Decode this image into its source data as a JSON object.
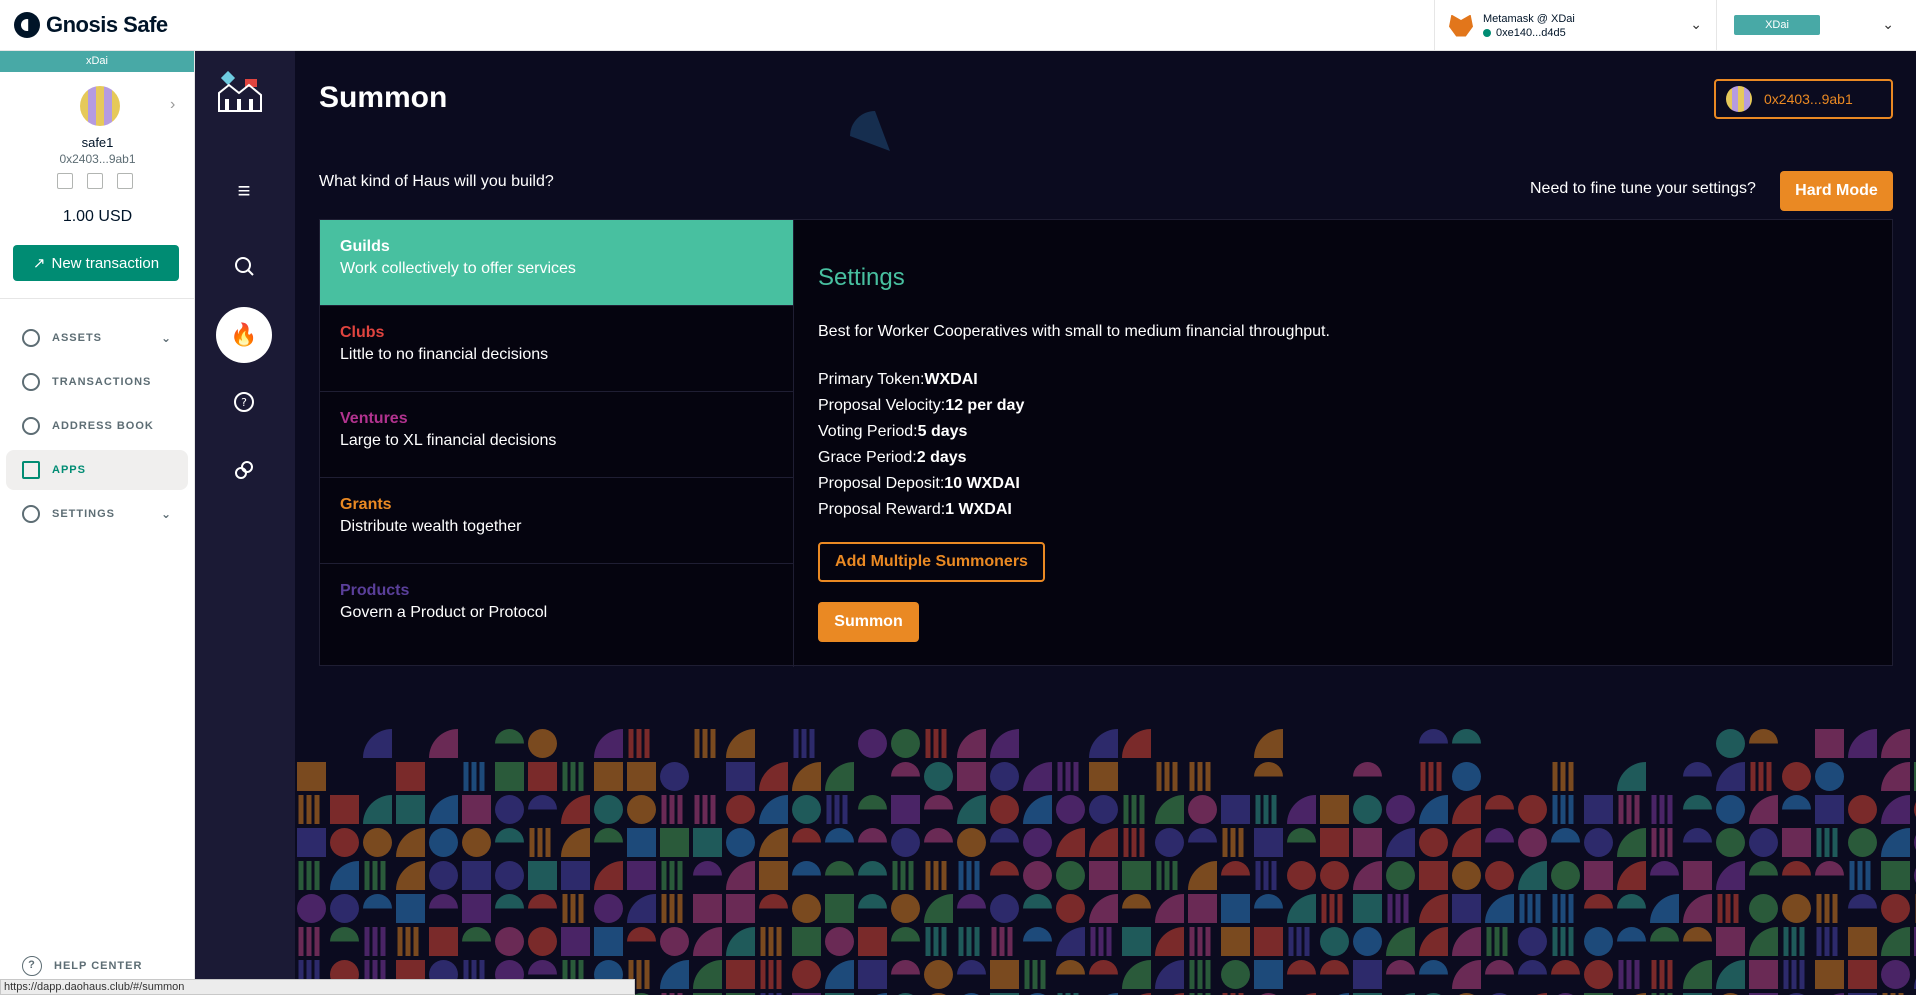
{
  "app": {
    "brand": "Gnosis Safe"
  },
  "wallet": {
    "provider": "Metamask @ XDai",
    "address": "0xe140...d4d5",
    "network": "XDai"
  },
  "safe": {
    "network": "xDai",
    "name": "safe1",
    "address": "0x2403...9ab1",
    "balance": "1.00 USD",
    "new_tx": "New transaction",
    "nav": [
      {
        "label": "ASSETS"
      },
      {
        "label": "TRANSACTIONS"
      },
      {
        "label": "ADDRESS BOOK"
      },
      {
        "label": "APPS"
      },
      {
        "label": "SETTINGS"
      }
    ],
    "help": "HELP CENTER"
  },
  "main": {
    "title": "Summon",
    "account": "0x2403...9ab1",
    "question": "What kind of Haus will you build?",
    "tune": "Need to fine tune your settings?",
    "hard_mode": "Hard Mode",
    "types": [
      {
        "name": "Guilds",
        "desc": "Work collectively to offer services",
        "color": "#ffffff"
      },
      {
        "name": "Clubs",
        "desc": "Little to no financial decisions",
        "color": "#e0443f"
      },
      {
        "name": "Ventures",
        "desc": "Large to XL financial decisions",
        "color": "#b2338f"
      },
      {
        "name": "Grants",
        "desc": "Distribute wealth together",
        "color": "#ea8923"
      },
      {
        "name": "Products",
        "desc": "Govern a Product or Protocol",
        "color": "#5a3f9a"
      }
    ],
    "settings": {
      "title": "Settings",
      "best": "Best for Worker Cooperatives with small to medium financial throughput.",
      "rows": [
        {
          "label": "Primary Token:",
          "value": "WXDAI"
        },
        {
          "label": "Proposal Velocity:",
          "value": "12 per day"
        },
        {
          "label": "Voting Period:",
          "value": "5 days"
        },
        {
          "label": "Grace Period:",
          "value": "2 days"
        },
        {
          "label": "Proposal Deposit:",
          "value": "10 WXDAI"
        },
        {
          "label": "Proposal Reward:",
          "value": "1 WXDAI"
        }
      ],
      "add_summoners": "Add Multiple Summoners",
      "summon": "Summon"
    }
  },
  "status_url": "https://dapp.daohaus.club/#/summon"
}
